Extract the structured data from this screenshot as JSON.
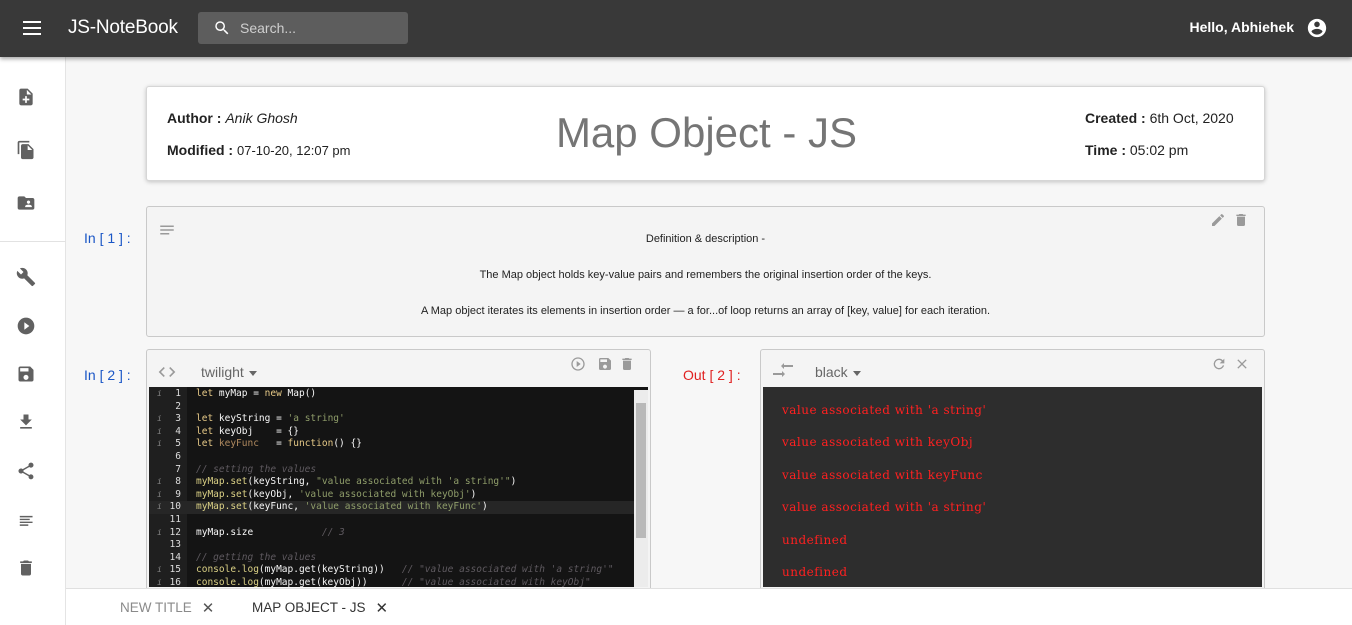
{
  "app": {
    "title": "JS-NoteBook",
    "greeting": "Hello, Abhiehek"
  },
  "search": {
    "placeholder": "Search..."
  },
  "sidebar": {
    "icons": [
      "note-add-icon",
      "copy-notes-icon",
      "folder-user-icon",
      "wrench-icon",
      "play-circle-icon",
      "save-icon",
      "download-icon",
      "share-icon",
      "list-icon",
      "trash-icon"
    ]
  },
  "notebook": {
    "author_label": "Author :",
    "author": "Anik Ghosh",
    "modified_label": "Modified :",
    "modified": "07-10-20, 12:07 pm",
    "title": "Map Object - JS",
    "created_label": "Created :",
    "created": "6th Oct, 2020",
    "time_label": "Time :",
    "time": "05:02 pm"
  },
  "cells": [
    {
      "label": "In [ 1 ] :",
      "type": "markdown",
      "lines": [
        "Definition & description -",
        "The Map object holds key-value pairs and remembers the original insertion order of the keys.",
        "A Map object iterates its elements in insertion order — a for...of loop returns an array of [key, value] for each iteration."
      ]
    },
    {
      "label": "In [ 2 ] :",
      "type": "code",
      "theme": "twilight",
      "line_numbers": [
        "1",
        "2",
        "3",
        "4",
        "5",
        "6",
        "7",
        "8",
        "9",
        "10",
        "11",
        "12",
        "13",
        "14",
        "15",
        "16"
      ],
      "markers": [
        "i",
        "",
        "i",
        "i",
        "i",
        "",
        "",
        "i",
        "i",
        "i",
        "",
        "i",
        "",
        "",
        "i",
        "i"
      ],
      "active_line": 10,
      "code": [
        [
          [
            "kw",
            "let "
          ],
          [
            "",
            "myMap = "
          ],
          [
            "kw",
            "new "
          ],
          [
            "",
            "Map()"
          ]
        ],
        [],
        [
          [
            "kw",
            "let "
          ],
          [
            "",
            "keyString = "
          ],
          [
            "str",
            "'a string'"
          ]
        ],
        [
          [
            "kw",
            "let "
          ],
          [
            "",
            "keyObj    = {}"
          ]
        ],
        [
          [
            "kw",
            "let "
          ],
          [
            "var",
            "keyFunc"
          ],
          [
            "",
            "   = "
          ],
          [
            "kw",
            "function"
          ],
          [
            "",
            "() {}"
          ]
        ],
        [],
        [
          [
            "cmt",
            "// setting the values"
          ]
        ],
        [
          [
            "fn",
            "myMap.set"
          ],
          [
            "",
            "(keyString, "
          ],
          [
            "str",
            "\"value associated with 'a string'\""
          ],
          [
            "",
            ")"
          ]
        ],
        [
          [
            "fn",
            "myMap.set"
          ],
          [
            "",
            "(keyObj, "
          ],
          [
            "str",
            "'value associated with keyObj'"
          ],
          [
            "",
            ")"
          ]
        ],
        [
          [
            "fn",
            "myMap.set"
          ],
          [
            "",
            "(keyFunc, "
          ],
          [
            "str",
            "'value associated with keyFunc'"
          ],
          [
            "",
            ")"
          ]
        ],
        [],
        [
          [
            "",
            "myMap.size            "
          ],
          [
            "cmt",
            "// 3"
          ]
        ],
        [],
        [
          [
            "cmt",
            "// getting the values"
          ]
        ],
        [
          [
            "fn",
            "console.log"
          ],
          [
            "",
            "(myMap.get(keyString))   "
          ],
          [
            "cmt",
            "// \"value associated with 'a string'\""
          ]
        ],
        [
          [
            "fn",
            "console.log"
          ],
          [
            "",
            "(myMap.get(keyObj))      "
          ],
          [
            "cmt",
            "// \"value associated with keyObj\""
          ]
        ]
      ]
    }
  ],
  "output": {
    "label": "Out [ 2 ] :",
    "theme": "black",
    "lines": [
      "value associated with 'a string'",
      "value associated with keyObj",
      "value associated with keyFunc",
      "value associated with 'a string'",
      "undefined",
      "undefined"
    ]
  },
  "tabs": [
    {
      "label": "NEW TITLE",
      "close": "✕",
      "active": false
    },
    {
      "label": "MAP OBJECT - JS",
      "close": "✕",
      "active": true
    }
  ],
  "colors": {
    "topbar": "#393939",
    "in_label": "#1a56c6",
    "out_label": "#e02020",
    "output_text": "#ff2020",
    "output_bg": "#2d2d2d",
    "editor_bg": "#141414"
  }
}
